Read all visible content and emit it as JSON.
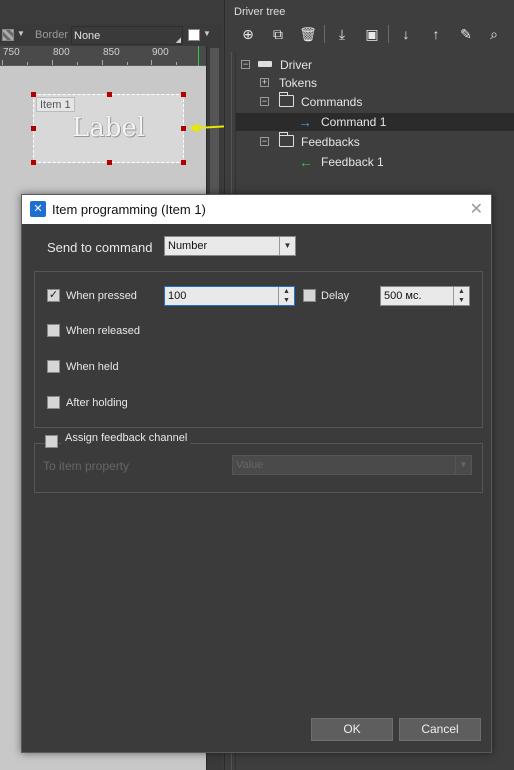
{
  "toolbar": {
    "border_label": "Border",
    "border_value": "None"
  },
  "ruler": {
    "labels": [
      "750",
      "800",
      "850",
      "900"
    ]
  },
  "canvas": {
    "item_tag": "Item 1",
    "label_text": "Label"
  },
  "driver_tree": {
    "title": "Driver tree",
    "nodes": {
      "driver": "Driver",
      "tokens": "Tokens",
      "commands": "Commands",
      "command1": "Command 1",
      "feedbacks": "Feedbacks",
      "feedback1": "Feedback 1"
    }
  },
  "dialog": {
    "title": "Item programming  (Item 1)",
    "send_to_command_label": "Send to command",
    "send_to_command_value": "Number",
    "when_pressed": {
      "label": "When pressed",
      "checked": true,
      "value": "100"
    },
    "delay": {
      "label": "Delay",
      "checked": false,
      "value": "500 мс."
    },
    "when_released": {
      "label": "When released",
      "checked": false
    },
    "when_held": {
      "label": "When held",
      "checked": false
    },
    "after_holding": {
      "label": "After holding",
      "checked": false
    },
    "assign_feedback": {
      "label": "Assign  feedback channel",
      "checked": false
    },
    "to_item_property": {
      "label": "To item property",
      "value": "Value"
    },
    "ok_label": "OK",
    "cancel_label": "Cancel"
  },
  "colors": {
    "accent": "#1e6fd0",
    "arrow": "#e8e800",
    "selection": "#2b2b2b"
  }
}
